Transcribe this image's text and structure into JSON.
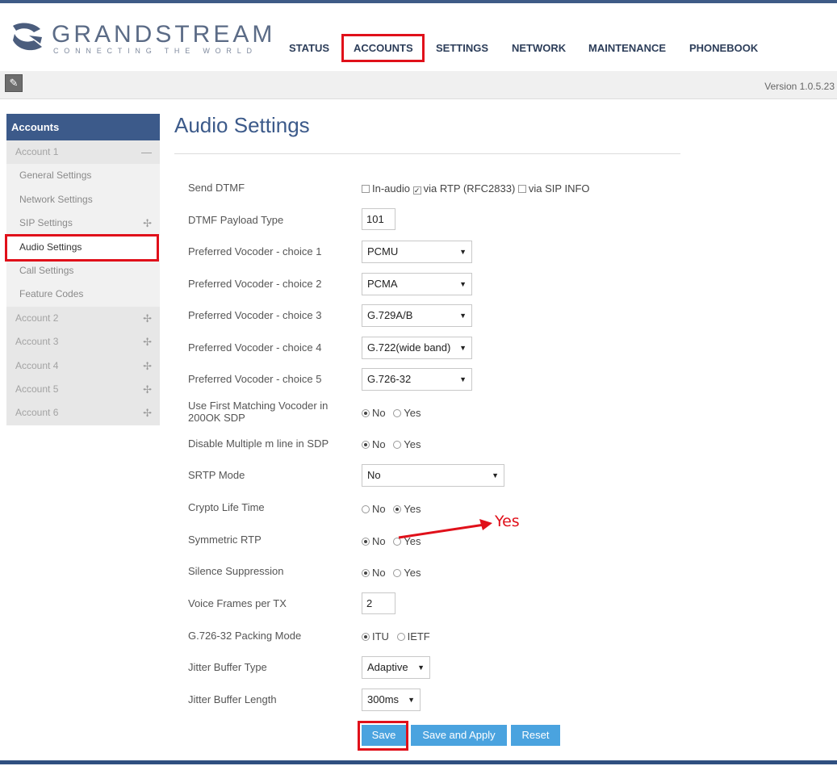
{
  "logo": {
    "name": "GRANDSTREAM",
    "tagline": "CONNECTING THE WORLD"
  },
  "nav": {
    "status": "STATUS",
    "accounts": "ACCOUNTS",
    "settings": "SETTINGS",
    "network": "NETWORK",
    "maintenance": "MAINTENANCE",
    "phonebook": "PHONEBOOK"
  },
  "toolbar": {
    "version": "Version 1.0.5.23"
  },
  "sidebar": {
    "header": "Accounts",
    "account1": "Account 1",
    "collapse_symbol": "—",
    "expand_symbol": "✢",
    "items": [
      "General Settings",
      "Network Settings",
      "SIP Settings",
      "Audio Settings",
      "Call Settings",
      "Feature Codes"
    ],
    "accounts": [
      "Account 2",
      "Account 3",
      "Account 4",
      "Account 5",
      "Account 6"
    ]
  },
  "page": {
    "title": "Audio Settings"
  },
  "form": {
    "send_dtmf": {
      "label": "Send DTMF",
      "options": [
        "In-audio",
        "via RTP (RFC2833)",
        "via SIP INFO"
      ],
      "checked": [
        false,
        true,
        false
      ]
    },
    "dtmf_payload": {
      "label": "DTMF Payload Type",
      "value": "101"
    },
    "vocoder1": {
      "label": "Preferred Vocoder - choice 1",
      "value": "PCMU"
    },
    "vocoder2": {
      "label": "Preferred Vocoder - choice 2",
      "value": "PCMA"
    },
    "vocoder3": {
      "label": "Preferred Vocoder - choice 3",
      "value": "G.729A/B"
    },
    "vocoder4": {
      "label": "Preferred Vocoder - choice 4",
      "value": "G.722(wide band)"
    },
    "vocoder5": {
      "label": "Preferred Vocoder - choice 5",
      "value": "G.726-32"
    },
    "first_match": {
      "label_line1": "Use First Matching Vocoder in",
      "label_line2": "200OK SDP",
      "selected": "No"
    },
    "multi_m": {
      "label": "Disable Multiple m line in SDP",
      "selected": "No"
    },
    "srtp": {
      "label": "SRTP Mode",
      "value": "No"
    },
    "crypto": {
      "label": "Crypto Life Time",
      "selected": "Yes"
    },
    "symmetric": {
      "label": "Symmetric RTP",
      "selected": "No"
    },
    "silence": {
      "label": "Silence Suppression",
      "selected": "No"
    },
    "voice_frames": {
      "label": "Voice Frames per TX",
      "value": "2"
    },
    "packing": {
      "label": "G.726-32 Packing Mode",
      "options": [
        "ITU",
        "IETF"
      ],
      "selected": "ITU"
    },
    "jitter_type": {
      "label": "Jitter Buffer Type",
      "value": "Adaptive"
    },
    "jitter_len": {
      "label": "Jitter Buffer Length",
      "value": "300ms"
    },
    "no": "No",
    "yes": "Yes",
    "dropdown_arrow": "▼"
  },
  "buttons": {
    "save": "Save",
    "save_apply": "Save and Apply",
    "reset": "Reset"
  },
  "annotation": {
    "text": "Yes",
    "color": "#e0101a"
  },
  "colors": {
    "brand": "#3c5a8a",
    "button": "#4aa3df",
    "highlight": "#e0101a"
  }
}
